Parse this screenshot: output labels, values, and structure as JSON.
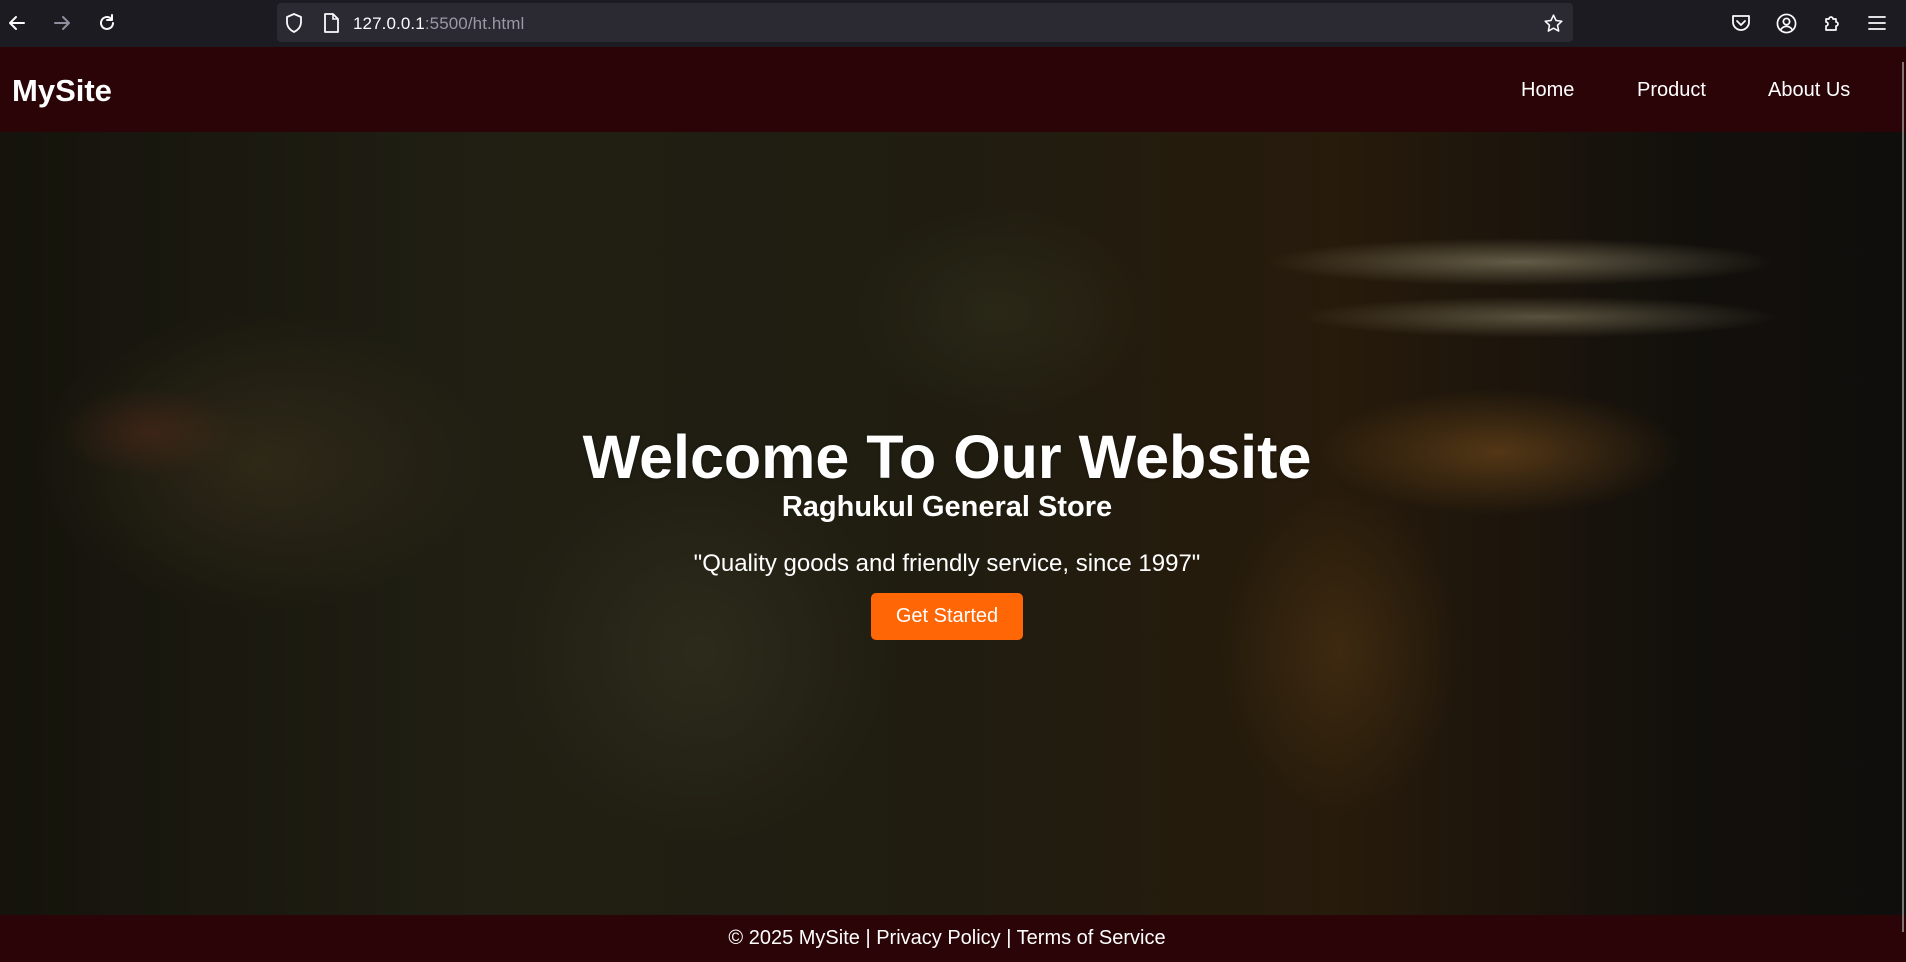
{
  "browser": {
    "url_host": "127.0.0.1",
    "url_rest": ":5500/ht.html",
    "icons": [
      "back-icon",
      "forward-icon",
      "reload-icon",
      "shield-icon",
      "page-icon",
      "bookmark-star-icon",
      "pocket-icon",
      "account-icon",
      "extensions-icon",
      "menu-icon"
    ]
  },
  "header": {
    "logo": "MySite",
    "nav": [
      {
        "label": "Home"
      },
      {
        "label": "Product"
      },
      {
        "label": "About Us"
      }
    ]
  },
  "hero": {
    "title": "Welcome To Our Website",
    "subtitle": "Raghukul General Store",
    "tagline": "\"Quality goods and friendly service, since 1997\"",
    "cta_label": "Get Started"
  },
  "footer": {
    "copyright": "© 2025 MySite",
    "separator": "|",
    "privacy": "Privacy Policy",
    "terms": "Terms of Service"
  },
  "colors": {
    "header_bg": "#2a0406",
    "cta_bg": "#ff6606",
    "text": "#ffffff"
  }
}
